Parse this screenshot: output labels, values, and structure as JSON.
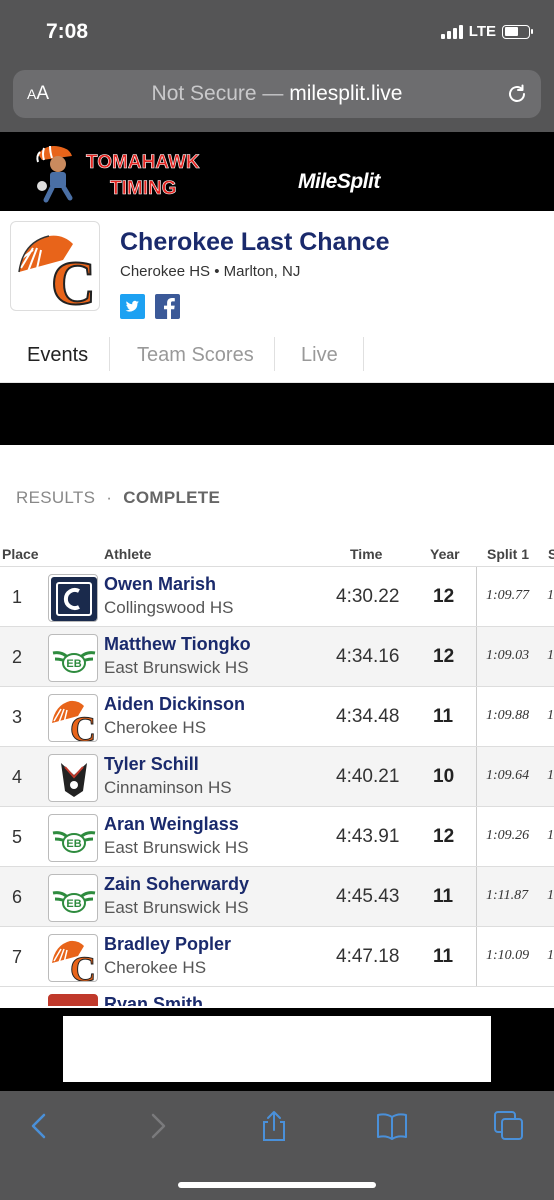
{
  "status": {
    "time": "7:08",
    "network": "LTE"
  },
  "url_bar": {
    "aa_label": "AA",
    "not_secure": "Not Secure —",
    "domain": "milesplit.live"
  },
  "banner": {
    "left_logo_line1": "TOMAHAWK",
    "left_logo_line2": "TIMING",
    "right_logo": "MileSplit"
  },
  "meet": {
    "logo_letter": "C",
    "title": "Cherokee Last Chance",
    "subtitle": "Cherokee HS • Marlton, NJ"
  },
  "tabs": [
    {
      "label": "Events",
      "active": true
    },
    {
      "label": "Team Scores",
      "active": false
    },
    {
      "label": "Live",
      "active": false
    }
  ],
  "results": {
    "label": "RESULTS",
    "dot": "·",
    "status": "COMPLETE"
  },
  "table": {
    "headers": {
      "place": "Place",
      "athlete": "Athlete",
      "time": "Time",
      "year": "Year",
      "split1": "Split 1",
      "split2": "S"
    },
    "rows": [
      {
        "place": "1",
        "name": "Owen Marish",
        "team": "Collingswood HS",
        "time": "4:30.22",
        "year": "12",
        "split1": "1:09.77",
        "split2": "1",
        "logo": "collingswood-logo"
      },
      {
        "place": "2",
        "name": "Matthew Tiongko",
        "team": "East Brunswick HS",
        "time": "4:34.16",
        "year": "12",
        "split1": "1:09.03",
        "split2": "1",
        "logo": "east-brunswick-logo"
      },
      {
        "place": "3",
        "name": "Aiden Dickinson",
        "team": "Cherokee HS",
        "time": "4:34.48",
        "year": "11",
        "split1": "1:09.88",
        "split2": "1",
        "logo": "cherokee-logo"
      },
      {
        "place": "4",
        "name": "Tyler Schill",
        "team": "Cinnaminson HS",
        "time": "4:40.21",
        "year": "10",
        "split1": "1:09.64",
        "split2": "1",
        "logo": "cinnaminson-logo"
      },
      {
        "place": "5",
        "name": "Aran Weinglass",
        "team": "East Brunswick HS",
        "time": "4:43.91",
        "year": "12",
        "split1": "1:09.26",
        "split2": "1",
        "logo": "east-brunswick-logo"
      },
      {
        "place": "6",
        "name": "Zain Soherwardy",
        "team": "East Brunswick HS",
        "time": "4:45.43",
        "year": "11",
        "split1": "1:11.87",
        "split2": "1",
        "logo": "east-brunswick-logo"
      },
      {
        "place": "7",
        "name": "Bradley Popler",
        "team": "Cherokee HS",
        "time": "4:47.18",
        "year": "11",
        "split1": "1:10.09",
        "split2": "1",
        "logo": "cherokee-logo"
      }
    ],
    "partial_row": {
      "name": "Ryan Smith"
    }
  },
  "colors": {
    "navy": "#1a2a6c",
    "orange": "#e8641a",
    "eb_green": "#2e8b3e",
    "chrome": "#555556",
    "toolbar_blue": "#4a90d9"
  }
}
